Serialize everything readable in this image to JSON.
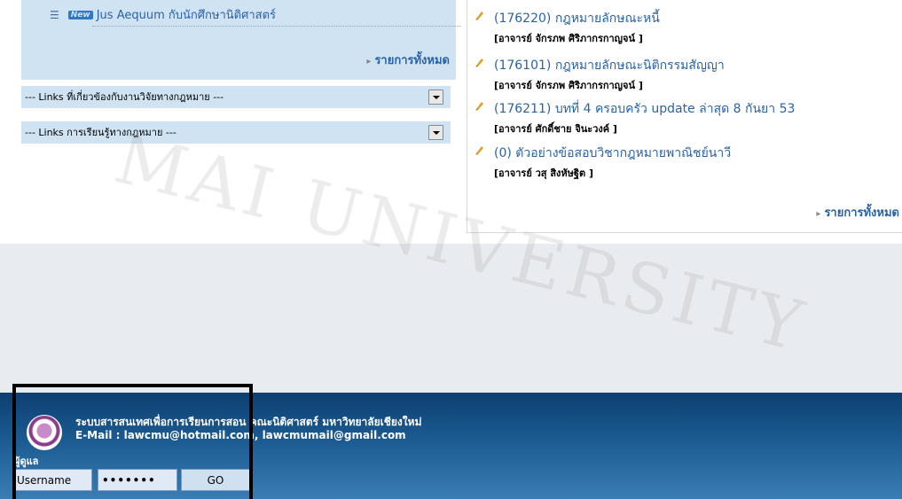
{
  "left": {
    "news_item": "Jus Aequum กับนักศึกษานิติศาสตร์",
    "new_badge": "New",
    "all_link": "รายการทั้งหมด",
    "link_boxes": [
      "--- Links ที่เกี่ยวข้องกับงานวิจัยทางกฎหมาย ---",
      "--- Links การเรียนรู้ทางกฎหมาย ---"
    ]
  },
  "right": {
    "courses": [
      {
        "title": "(176220) กฎหมายลักษณะหนี้",
        "teacher": "[อาจารย์ จักรภพ ศิริภากรกาญจน์ ]"
      },
      {
        "title": "(176101) กฎหมายลักษณะนิติกรรมสัญญา",
        "teacher": "[อาจารย์ จักรภพ ศิริภากรกาญจน์ ]"
      },
      {
        "title": "(176211) บทที่ 4 ครอบครัว update ล่าสุด 8 กันยา 53",
        "teacher": "[อาจารย์ ศักดิ์ชาย จินะวงค์ ]"
      },
      {
        "title": "(0) ตัวอย่างข้อสอบวิชากฎหมายพาณิชย์นาวี",
        "teacher": "[อาจารย์ วสุ สิงหัษฐิต ]"
      }
    ],
    "all_link": "รายการทั้งหมด"
  },
  "footer": {
    "line1": "ระบบสารสนเทศเพื่อการเรียนการสอน คณะนิติศาสตร์ มหาวิทยาลัยเชียงใหม่",
    "line2": "E-Mail : lawcmu@hotmail.com, lawcmumail@gmail.com",
    "admin_label": "ผู้ดูแล",
    "username_value": "Username",
    "password_value": "•••••••",
    "go_label": "GO"
  },
  "watermark": "MAI UNIVERSITY",
  "colors": {
    "link_blue": "#2a62a8",
    "panel_blue": "#cfe3f2",
    "footer_dark": "#0d3f70",
    "footer_light": "#3a7cb4"
  }
}
